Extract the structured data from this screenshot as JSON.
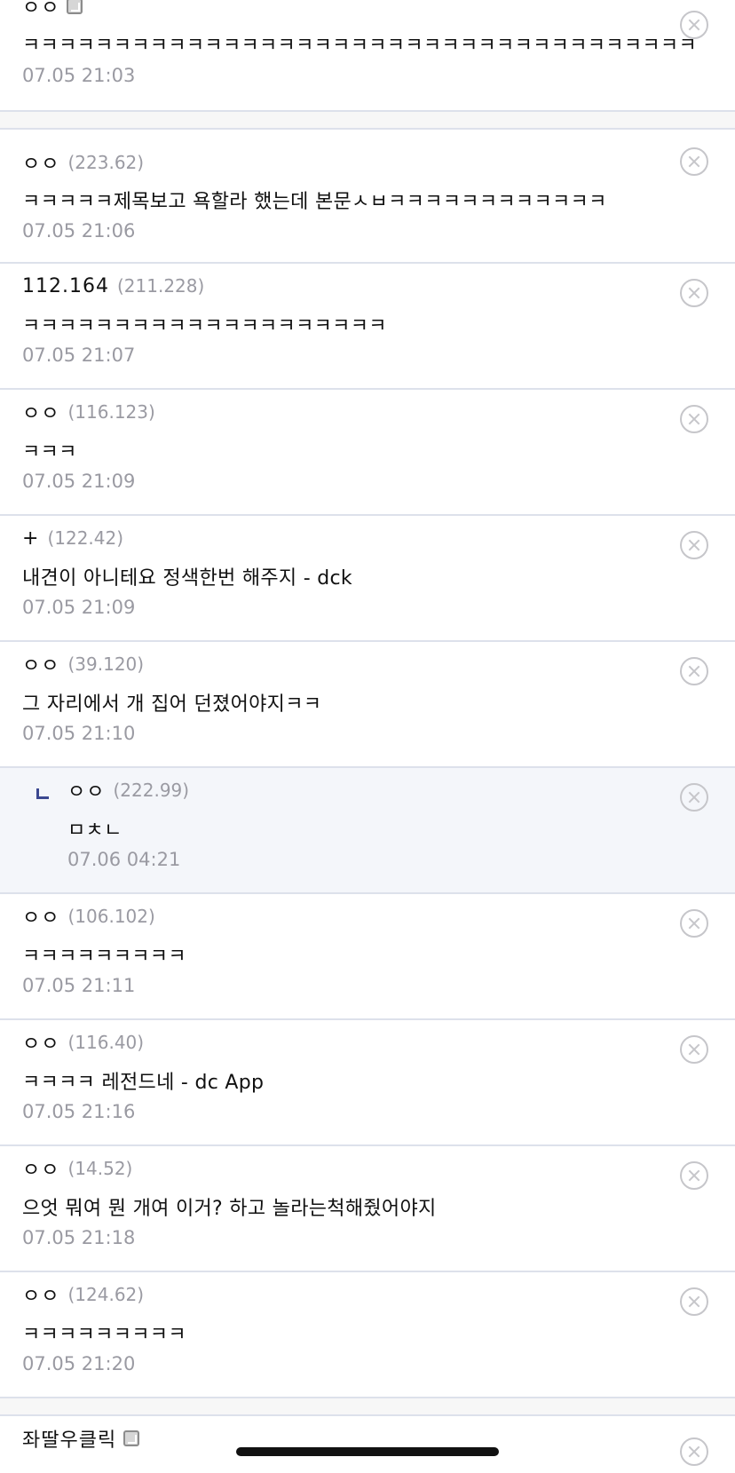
{
  "comments": [
    {
      "nick": "ㅇㅇ",
      "ip": "",
      "gallog": true,
      "text": "ㅋㅋㅋㅋㅋㅋㅋㅋㅋㅋㅋㅋㅋㅋㅋㅋㅋㅋㅋㅋㅋㅋㅋㅋㅋㅋㅋㅋㅋㅋㅋㅋㅋㅋㅋㅋㅋ",
      "date": "07.05 21:03"
    },
    {
      "nick": "ㅇㅇ",
      "ip": "(223.62)",
      "text": "ㅋㅋㅋㅋㅋ제목보고 욕할라 했는데 본문ㅅㅂㅋㅋㅋㅋㅋㅋㅋㅋㅋㅋㅋㅋ",
      "date": "07.05 21:06"
    },
    {
      "nick": "112.164",
      "ip": "(211.228)",
      "text": "ㅋㅋㅋㅋㅋㅋㅋㅋㅋㅋㅋㅋㅋㅋㅋㅋㅋㅋㅋㅋ",
      "date": "07.05 21:07"
    },
    {
      "nick": "ㅇㅇ",
      "ip": "(116.123)",
      "text": "ㅋㅋㅋ",
      "date": "07.05 21:09"
    },
    {
      "nick": "+",
      "ip": "(122.42)",
      "text": "내견이 아니테요 정색한번 해주지 - dck",
      "date": "07.05 21:09"
    },
    {
      "nick": "ㅇㅇ",
      "ip": "(39.120)",
      "text": "그 자리에서 개 집어 던졌어야지ㅋㅋ",
      "date": "07.05 21:10"
    },
    {
      "nick": "ㅇㅇ",
      "ip": "(222.99)",
      "text": "ㅁㅊㄴ",
      "date": "07.06 04:21",
      "reply": true
    },
    {
      "nick": "ㅇㅇ",
      "ip": "(106.102)",
      "text": "ㅋㅋㅋㅋㅋㅋㅋㅋㅋ",
      "date": "07.05 21:11"
    },
    {
      "nick": "ㅇㅇ",
      "ip": "(116.40)",
      "text": "ㅋㅋㅋㅋ 레전드네 - dc App",
      "date": "07.05 21:16"
    },
    {
      "nick": "ㅇㅇ",
      "ip": "(14.52)",
      "text": "으엇 뭐여 뭔 개여 이거? 하고 놀라는척해줬어야지",
      "date": "07.05 21:18"
    },
    {
      "nick": "ㅇㅇ",
      "ip": "(124.62)",
      "text": "ㅋㅋㅋㅋㅋㅋㅋㅋㅋ",
      "date": "07.05 21:20"
    },
    {
      "nick": "좌딸우클릭",
      "ip": "",
      "gallog": true,
      "text": "",
      "date": ""
    }
  ],
  "icons": {
    "delete": "close-circle-icon",
    "gallog": "gallog-icon",
    "reply": "reply-arrow-icon"
  },
  "colors": {
    "reply_background": "#f4f6fa",
    "reply_marker": "#3b4890",
    "meta_gray": "#9a9aa2",
    "divider": "#dde1eb"
  }
}
